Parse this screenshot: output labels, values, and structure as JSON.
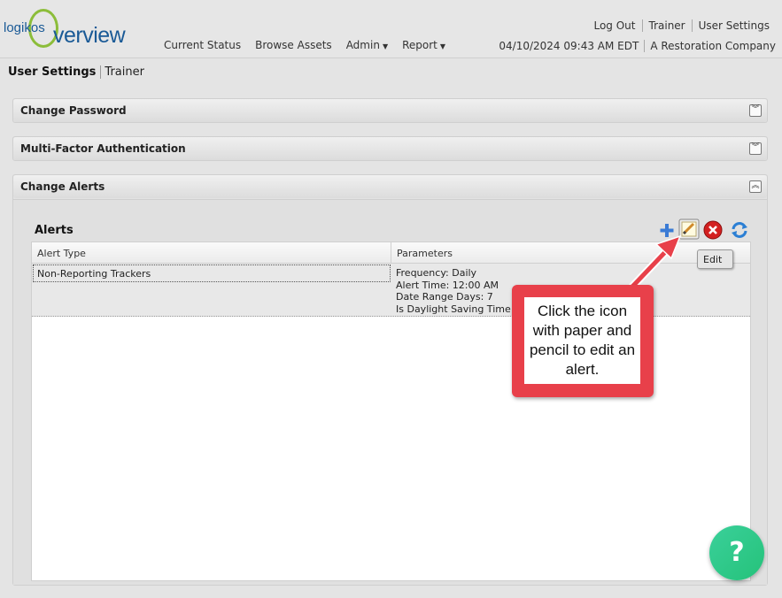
{
  "brand": {
    "logo_small": "logikos",
    "logo_big": "verview"
  },
  "nav": {
    "items": [
      "Current Status",
      "Browse Assets",
      "Admin",
      "Report"
    ]
  },
  "top_links": [
    "Log Out",
    "Trainer",
    "User Settings"
  ],
  "status": {
    "datetime": "04/10/2024 09:43 AM EDT",
    "company": "A Restoration Company"
  },
  "breadcrumb": {
    "main": "User Settings",
    "sub": "Trainer"
  },
  "panels": [
    {
      "title": "Change Password",
      "state": "collapsed"
    },
    {
      "title": "Multi-Factor Authentication",
      "state": "collapsed"
    },
    {
      "title": "Change Alerts",
      "state": "expanded"
    }
  ],
  "alerts": {
    "title": "Alerts",
    "columns": [
      "Alert Type",
      "Parameters"
    ],
    "rows": [
      {
        "type": "Non-Reporting Trackers",
        "params": [
          "Frequency: Daily",
          "Alert Time: 12:00 AM",
          "Date Range Days: 7",
          "Is Daylight Saving Time: tr"
        ]
      }
    ],
    "toolbar": [
      "add-icon",
      "edit-icon",
      "delete-icon",
      "refresh-icon"
    ]
  },
  "tooltip": "Edit",
  "callout": "Click the icon with paper and pencil to edit an alert.",
  "help": "?",
  "colors": {
    "brand_blue": "#1a5a96",
    "brand_green": "#8cbd3a",
    "callout_red": "#e8404a",
    "help_green": "#2ecb88"
  }
}
